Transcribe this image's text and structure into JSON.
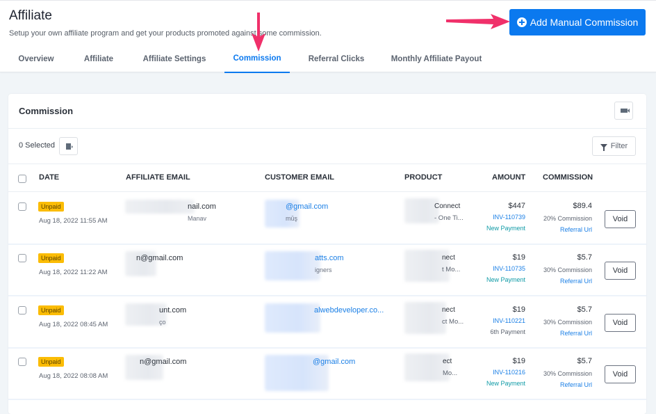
{
  "header": {
    "title": "Affiliate",
    "subtitle": "Setup your own affiliate program and get your products promoted against some commission.",
    "add_button_label": "Add Manual Commission",
    "accent_color": "#0b79ef",
    "annotation_color": "#f0306a"
  },
  "tabs": [
    {
      "label": "Overview",
      "active": false
    },
    {
      "label": "Affiliate",
      "active": false
    },
    {
      "label": "Affiliate Settings",
      "active": false
    },
    {
      "label": "Commission",
      "active": true
    },
    {
      "label": "Referral Clicks",
      "active": false
    },
    {
      "label": "Monthly Affiliate Payout",
      "active": false
    }
  ],
  "card": {
    "title": "Commission",
    "selected_label": "0 Selected",
    "filter_label": "Filter",
    "icons": {
      "video": "video-camera-icon",
      "export": "export-icon",
      "filter": "filter-funnel-icon"
    }
  },
  "table": {
    "columns": [
      "DATE",
      "AFFILIATE EMAIL",
      "CUSTOMER EMAIL",
      "PRODUCT",
      "AMOUNT",
      "COMMISSION"
    ],
    "rows": [
      {
        "status": "Unpaid",
        "date": "Aug 18, 2022 11:55 AM",
        "affiliate_email": "nail.com",
        "affiliate_name": "Manav",
        "customer_email": "@gmail.com",
        "customer_name": "mūş",
        "product_name": "Connect",
        "product_variant": "- One Ti...",
        "amount": "$447",
        "invoice": "INV-110739",
        "payment_type": "New Payment",
        "commission": "$89.4",
        "commission_rate": "20% Commission",
        "referral": "Referral Url",
        "action": "Void"
      },
      {
        "status": "Unpaid",
        "date": "Aug 18, 2022 11:22 AM",
        "affiliate_email": "n@gmail.com",
        "affiliate_name": "",
        "customer_email": "atts.com",
        "customer_name": "igners",
        "product_name": "nect",
        "product_variant": "t Mo...",
        "amount": "$19",
        "invoice": "INV-110735",
        "payment_type": "New Payment",
        "commission": "$5.7",
        "commission_rate": "30% Commission",
        "referral": "Referral Url",
        "action": "Void"
      },
      {
        "status": "Unpaid",
        "date": "Aug 18, 2022 08:45 AM",
        "affiliate_email": "unt.com",
        "affiliate_name": "ço",
        "customer_email": "alwebdeveloper.co...",
        "customer_name": "",
        "product_name": "nect",
        "product_variant": "ct Mo...",
        "amount": "$19",
        "invoice": "INV-110221",
        "payment_type": "6th Payment",
        "commission": "$5.7",
        "commission_rate": "30% Commission",
        "referral": "Referral Url",
        "action": "Void"
      },
      {
        "status": "Unpaid",
        "date": "Aug 18, 2022 08:08 AM",
        "affiliate_email": "n@gmail.com",
        "affiliate_name": "",
        "customer_email": "@gmail.com",
        "customer_name": "",
        "product_name": "ect",
        "product_variant": "Mo...",
        "amount": "$19",
        "invoice": "INV-110216",
        "payment_type": "New Payment",
        "commission": "$5.7",
        "commission_rate": "30% Commission",
        "referral": "Referral Url",
        "action": "Void"
      }
    ]
  }
}
